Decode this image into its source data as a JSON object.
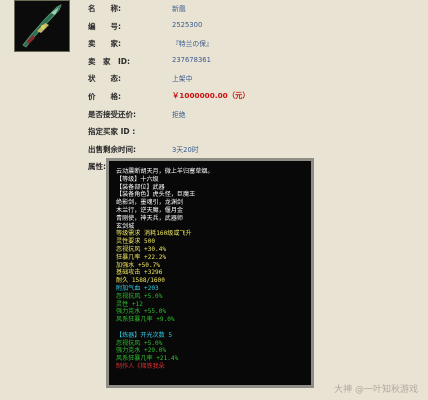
{
  "item_image": {
    "icon": "sword-item-icon"
  },
  "details": [
    {
      "label": "名　　称:",
      "value": "新凰"
    },
    {
      "label": "编　　号:",
      "value": "2525300"
    },
    {
      "label": "卖　　家:",
      "value": "『特兰の保』"
    },
    {
      "label": "卖　家　ID:",
      "value": "237678361"
    },
    {
      "label": "状　　态:",
      "value": "上架中"
    },
    {
      "label": "价　　格:",
      "value": "￥1000000.00（元）"
    },
    {
      "label": "是否接受还价:",
      "value": "拒绝"
    },
    {
      "label": "指定买家 ID :",
      "value": ""
    },
    {
      "label": "出售剩余时间:",
      "value": "3天20时"
    },
    {
      "label": "属性:",
      "value": ""
    }
  ],
  "attributes_panel": {
    "lines": [
      {
        "text": "云动震断胡天月，微上羊归塞草烟。",
        "color": "#ffffff"
      },
      {
        "text": "【等级】十六级",
        "color": "#ffffff"
      },
      {
        "text": "【装备部位】武器",
        "color": "#ffffff"
      },
      {
        "text": "【装备角色】虎头怪，巨魔王",
        "color": "#ffffff"
      },
      {
        "text": "绝影剑，墨魂引，龙渊剑",
        "color": "#ffffff"
      },
      {
        "text": "木兰行，逆天魔，偃月金",
        "color": "#ffffff"
      },
      {
        "text": "青刚使，神天兵，武器师",
        "color": "#ffffff"
      },
      {
        "text": "玄剑城",
        "color": "#ffffff"
      },
      {
        "text": "等级需求 消耗160级或飞升",
        "color": "#f0e860"
      },
      {
        "text": "灵性要求 500",
        "color": "#f0e860"
      },
      {
        "text": "忽视抗风 +30.4%",
        "color": "#f0e860"
      },
      {
        "text": "狂暴几率 +22.2%",
        "color": "#f0e860"
      },
      {
        "text": "加强水 +50.7%",
        "color": "#f0e860"
      },
      {
        "text": "基础攻击 +3296",
        "color": "#f0e860"
      },
      {
        "text": "耐久 1588/1600",
        "color": "#f0e860"
      },
      {
        "text": "附加气血 +203",
        "color": "#30d0e8"
      },
      {
        "text": "忽视抗风 +5.0%",
        "color": "#30c030"
      },
      {
        "text": "灵性 +12",
        "color": "#30c030"
      },
      {
        "text": "强力克水 +55.0%",
        "color": "#30c030"
      },
      {
        "text": "风系狂暴几率 +9.0%",
        "color": "#30c030"
      },
      {
        "text": "",
        "color": "#ffffff"
      },
      {
        "text": "【炼器】开光次数 5",
        "color": "#30d0e8"
      },
      {
        "text": "忽视抗风 +5.0%",
        "color": "#30c030"
      },
      {
        "text": "强力克水 +29.0%",
        "color": "#30c030"
      },
      {
        "text": "风系狂暴几率 +21.4%",
        "color": "#30c030"
      },
      {
        "text": "制作人《梯铁我朵",
        "color": "#e03030"
      }
    ]
  },
  "watermark": {
    "text": "大神 @一叶知秋游戏"
  }
}
